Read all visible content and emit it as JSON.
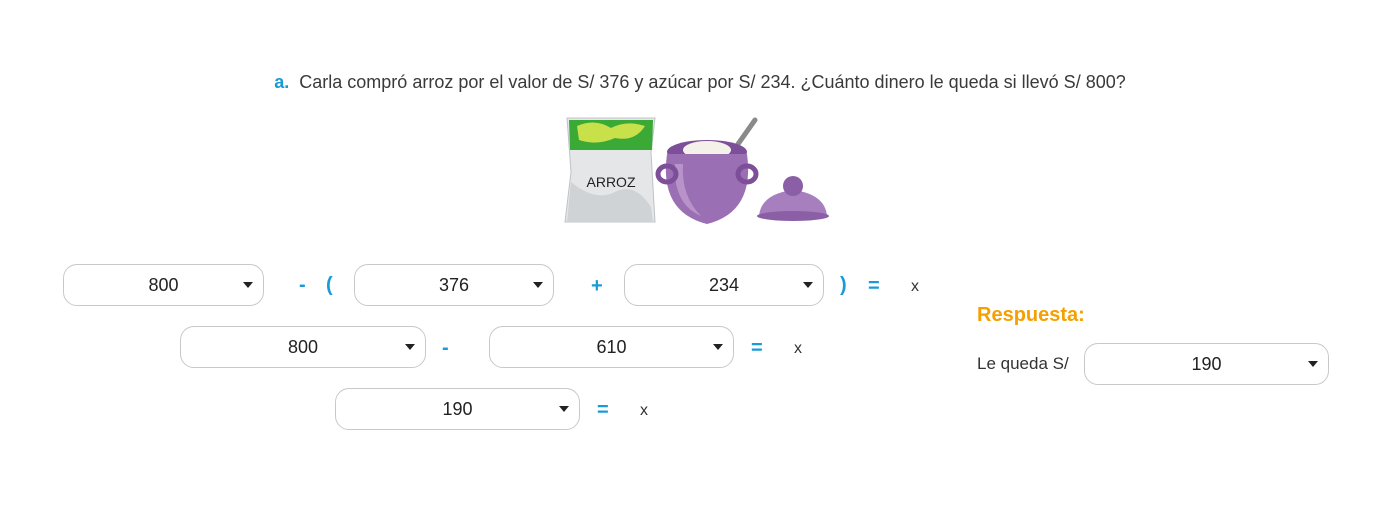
{
  "question": {
    "label": "a.",
    "text": "Carla compró arroz por el valor de S/ 376 y azúcar por S/ 234. ¿Cuánto dinero le queda si llevó S/ 800?"
  },
  "illustration": {
    "bag_text": "ARROZ",
    "bag_accent": "#3aa935",
    "pot_color": "#9b6fb3"
  },
  "row1": {
    "a": "800",
    "minus": "-",
    "lparen": "(",
    "b": "376",
    "plus": "+",
    "c": "234",
    "rparen": ")",
    "equals": "=",
    "var": "x"
  },
  "row2": {
    "a": "800",
    "minus": "-",
    "b": "610",
    "equals": "=",
    "var": "x"
  },
  "row3": {
    "a": "190",
    "equals": "=",
    "var": "x"
  },
  "answer": {
    "title": "Respuesta:",
    "label": "Le queda S/",
    "value": "190"
  },
  "colors": {
    "operator": "#1a9bd7",
    "answer_title": "#f5a000",
    "border": "#c9c9c9"
  }
}
